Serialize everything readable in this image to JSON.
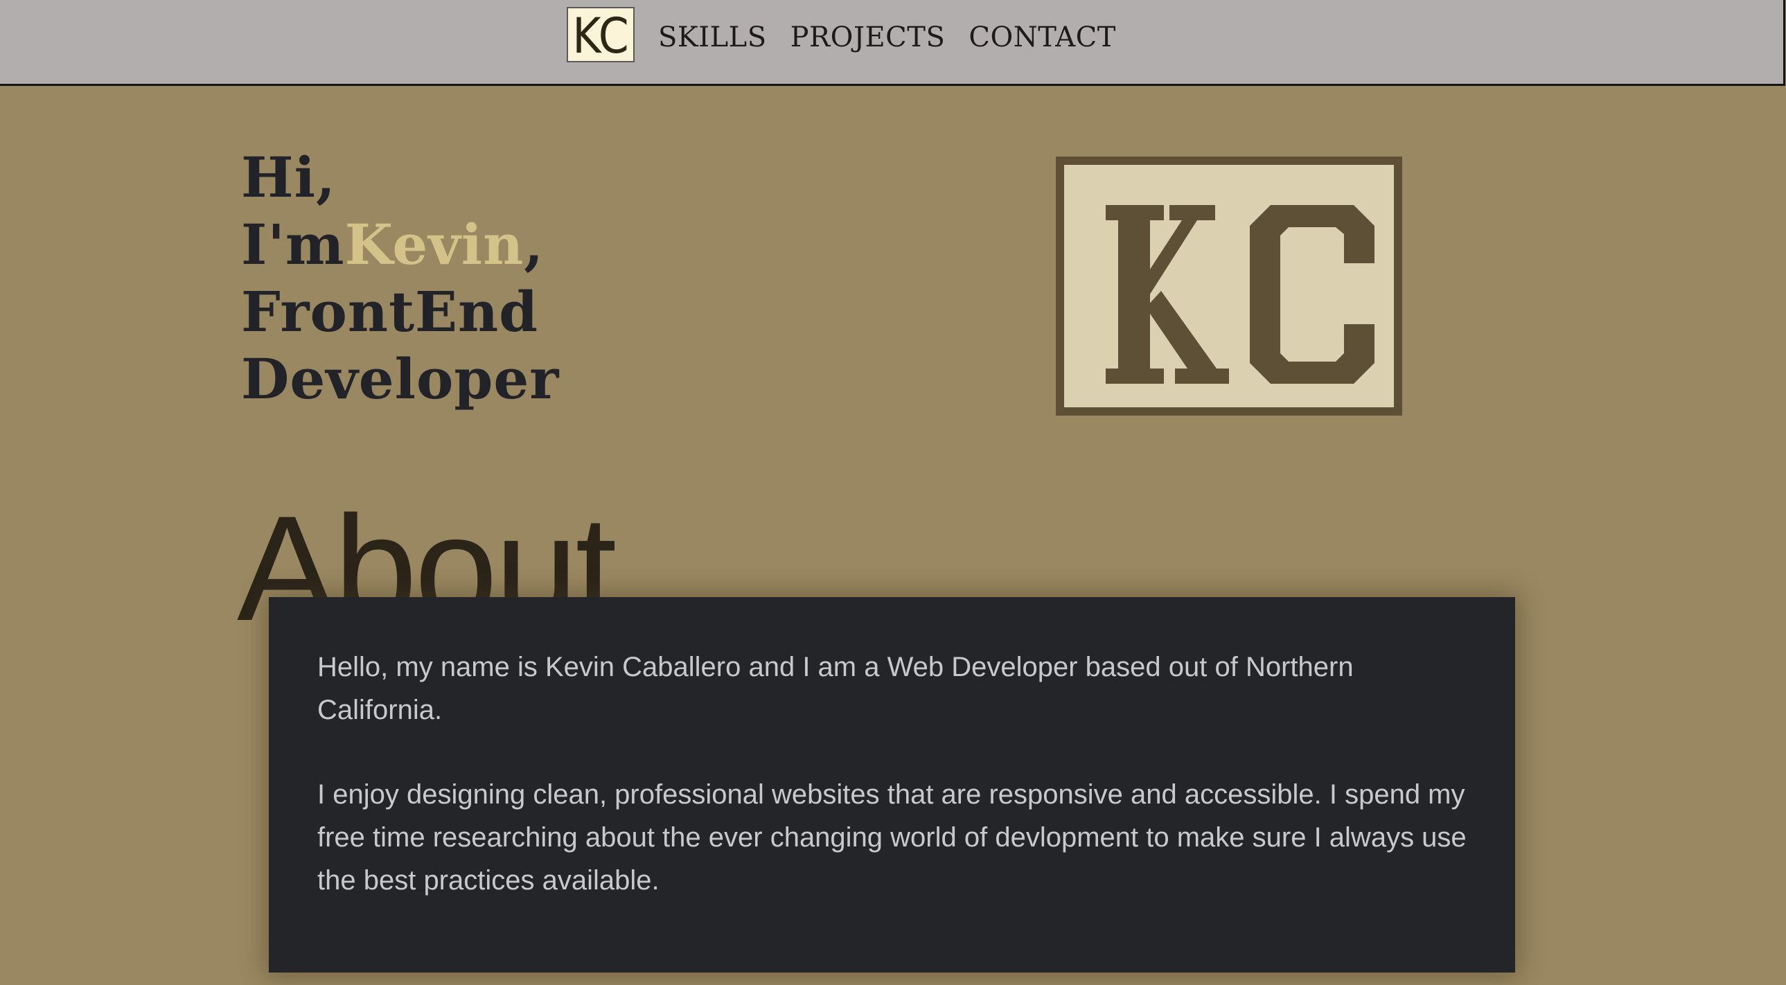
{
  "nav": {
    "logo_text": "KC",
    "links": [
      "SKILLS",
      "PROJECTS",
      "CONTACT"
    ]
  },
  "hero": {
    "greeting": "Hi,",
    "intro_prefix": "I'm",
    "name": "Kevin",
    "intro_suffix": ",",
    "role_line_1": "FrontEnd",
    "role_line_2": "Developer",
    "logo_text": "KC"
  },
  "about": {
    "heading": "About",
    "paragraphs": [
      "Hello, my name is Kevin Caballero and I am a Web Developer based out of Northern California.",
      "I enjoy designing clean, professional websites that are responsive and accessible. I spend my free time researching about the ever changing world of devlopment to make sure I always use the best practices available."
    ]
  },
  "colors": {
    "page_background": "#9a8862",
    "nav_background": "#b2aeae",
    "name_accent": "#d3c389",
    "card_background": "#242528",
    "logo_brown": "#5e4f37",
    "logo_cream": "#dbd0b0"
  }
}
